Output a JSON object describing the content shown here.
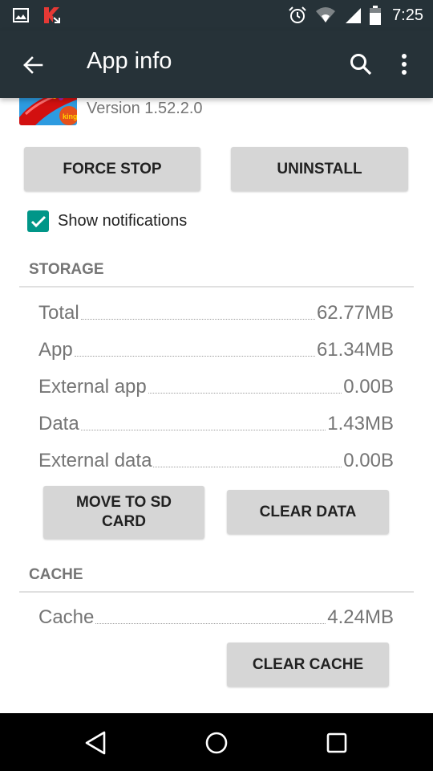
{
  "status_bar": {
    "left_icons": [
      "image-notification-icon",
      "kaspersky-notification-icon"
    ],
    "right_icons": [
      "alarm-icon",
      "wifi-icon",
      "cell-signal-icon",
      "battery-icon"
    ],
    "time": "7:25"
  },
  "app_bar": {
    "title": "App info",
    "back_icon": "arrow-back-icon",
    "actions": [
      "search-icon",
      "more-vert-icon"
    ]
  },
  "app": {
    "icon": "candy-crush-app-icon",
    "version": "Version 1.52.2.0"
  },
  "actions": {
    "force_stop": "FORCE STOP",
    "uninstall": "UNINSTALL"
  },
  "notifications": {
    "label": "Show notifications",
    "checked": true
  },
  "storage": {
    "title": "STORAGE",
    "rows": [
      {
        "label": "Total",
        "value": "62.77MB"
      },
      {
        "label": "App",
        "value": "61.34MB"
      },
      {
        "label": "External app",
        "value": "0.00B"
      },
      {
        "label": "Data",
        "value": "1.43MB"
      },
      {
        "label": "External data",
        "value": "0.00B"
      }
    ],
    "move_to_sd": "MOVE TO SD CARD",
    "clear_data": "CLEAR DATA"
  },
  "cache": {
    "title": "CACHE",
    "rows": [
      {
        "label": "Cache",
        "value": "4.24MB"
      }
    ],
    "clear_cache": "CLEAR CACHE"
  },
  "nav_bar": {
    "buttons": [
      "nav-back-icon",
      "nav-home-icon",
      "nav-recents-icon"
    ]
  },
  "colors": {
    "toolbar": "#263238",
    "accent": "#009688",
    "button": "#d6d6d6",
    "secondary_text": "#757575"
  }
}
